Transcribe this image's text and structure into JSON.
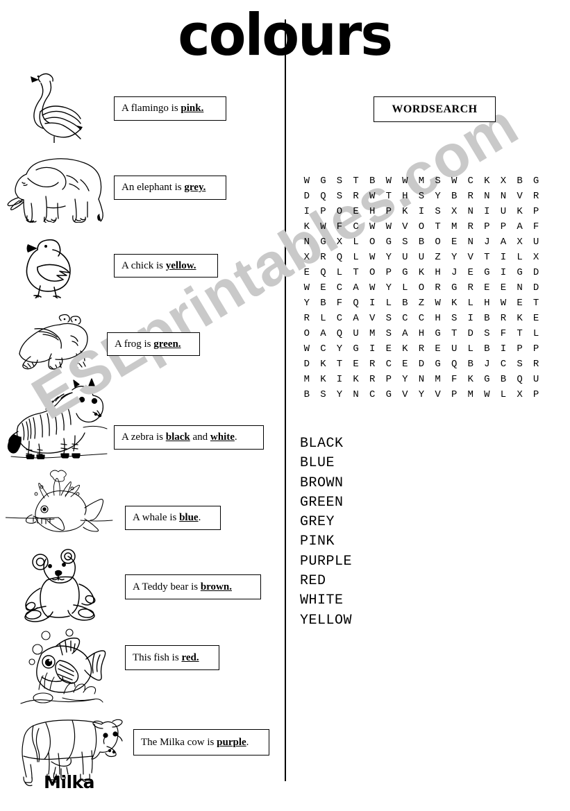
{
  "page": {
    "title": "colours",
    "watermark": "ESLprintables.com"
  },
  "left_column": {
    "items": [
      {
        "icon": "flamingo-illustration",
        "text_prefix": "A flamingo is ",
        "colour": "pink.",
        "text_suffix": ""
      },
      {
        "icon": "elephant-illustration",
        "text_prefix": "An elephant is ",
        "colour": "grey.",
        "text_suffix": ""
      },
      {
        "icon": "chick-illustration",
        "text_prefix": "A chick is ",
        "colour": "yellow.",
        "text_suffix": ""
      },
      {
        "icon": "frog-illustration",
        "text_prefix": "A frog is ",
        "colour": "green.",
        "text_suffix": ""
      },
      {
        "icon": "zebra-illustration",
        "text_prefix": "A zebra is ",
        "colour": "black",
        "text_middle": " and ",
        "colour2": "white",
        "text_suffix": "."
      },
      {
        "icon": "whale-illustration",
        "text_prefix": "A whale is ",
        "colour": "blue",
        "text_suffix": "."
      },
      {
        "icon": "teddy-bear-illustration",
        "text_prefix": "A Teddy bear is ",
        "colour": "brown.",
        "text_suffix": ""
      },
      {
        "icon": "fish-illustration",
        "text_prefix": "This fish is ",
        "colour": "red.",
        "text_suffix": ""
      },
      {
        "icon": "cow-illustration",
        "text_prefix": "The Milka cow is ",
        "colour": "purple",
        "text_suffix": ".",
        "label": "Milka"
      }
    ]
  },
  "wordsearch": {
    "header": "WORDSEARCH",
    "grid": [
      [
        "W",
        "G",
        "S",
        "T",
        "B",
        "W",
        "W",
        "M",
        "S",
        "W",
        "C",
        "K",
        "X",
        "B",
        "G"
      ],
      [
        "D",
        "Q",
        "S",
        "R",
        "W",
        "T",
        "H",
        "S",
        "Y",
        "B",
        "R",
        "N",
        "N",
        "V",
        "R"
      ],
      [
        "I",
        "P",
        "O",
        "E",
        "H",
        "P",
        "K",
        "I",
        "S",
        "X",
        "N",
        "I",
        "U",
        "K",
        "P"
      ],
      [
        "K",
        "W",
        "F",
        "C",
        "W",
        "W",
        "V",
        "O",
        "T",
        "M",
        "R",
        "P",
        "P",
        "A",
        "F"
      ],
      [
        "N",
        "G",
        "X",
        "L",
        "O",
        "G",
        "S",
        "B",
        "O",
        "E",
        "N",
        "J",
        "A",
        "X",
        "U"
      ],
      [
        "X",
        "R",
        "Q",
        "L",
        "W",
        "Y",
        "U",
        "U",
        "Z",
        "Y",
        "V",
        "T",
        "I",
        "L",
        "X"
      ],
      [
        "E",
        "Q",
        "L",
        "T",
        "O",
        "P",
        "G",
        "K",
        "H",
        "J",
        "E",
        "G",
        "I",
        "G",
        "D"
      ],
      [
        "W",
        "E",
        "C",
        "A",
        "W",
        "Y",
        "L",
        "O",
        "R",
        "G",
        "R",
        "E",
        "E",
        "N",
        "D"
      ],
      [
        "Y",
        "B",
        "F",
        "Q",
        "I",
        "L",
        "B",
        "Z",
        "W",
        "K",
        "L",
        "H",
        "W",
        "E",
        "T"
      ],
      [
        "R",
        "L",
        "C",
        "A",
        "V",
        "S",
        "C",
        "C",
        "H",
        "S",
        "I",
        "B",
        "R",
        "K",
        "E"
      ],
      [
        "O",
        "A",
        "Q",
        "U",
        "M",
        "S",
        "A",
        "H",
        "G",
        "T",
        "D",
        "S",
        "F",
        "T",
        "L"
      ],
      [
        "W",
        "C",
        "Y",
        "G",
        "I",
        "E",
        "K",
        "R",
        "E",
        "U",
        "L",
        "B",
        "I",
        "P",
        "P"
      ],
      [
        "D",
        "K",
        "T",
        "E",
        "R",
        "C",
        "E",
        "D",
        "G",
        "Q",
        "B",
        "J",
        "C",
        "S",
        "R"
      ],
      [
        "M",
        "K",
        "I",
        "K",
        "R",
        "P",
        "Y",
        "N",
        "M",
        "F",
        "K",
        "G",
        "B",
        "Q",
        "U"
      ],
      [
        "B",
        "S",
        "Y",
        "N",
        "C",
        "G",
        "V",
        "Y",
        "V",
        "P",
        "M",
        "W",
        "L",
        "X",
        "P"
      ]
    ],
    "words": [
      "BLACK",
      "BLUE",
      "BROWN",
      "GREEN",
      "GREY",
      "PINK",
      "PURPLE",
      "RED",
      "WHITE",
      "YELLOW"
    ]
  }
}
